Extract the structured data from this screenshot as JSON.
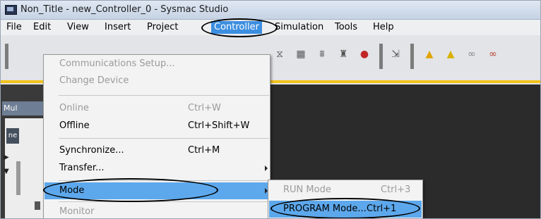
{
  "window": {
    "title": "Non_Title - new_Controller_0 - Sysmac Studio"
  },
  "menubar": {
    "items": [
      {
        "label": "File"
      },
      {
        "label": "Edit"
      },
      {
        "label": "View"
      },
      {
        "label": "Insert"
      },
      {
        "label": "Project"
      },
      {
        "label": "Controller"
      },
      {
        "label": "Simulation"
      },
      {
        "label": "Tools"
      },
      {
        "label": "Help"
      }
    ]
  },
  "left_panel": {
    "tab_label": "Mul",
    "chip_label": "ne"
  },
  "controller_menu": {
    "items": [
      {
        "label": "Communications Setup...",
        "shortcut": ""
      },
      {
        "label": "Change Device",
        "shortcut": ""
      },
      {
        "label": "Online",
        "shortcut": "Ctrl+W"
      },
      {
        "label": "Offline",
        "shortcut": "Ctrl+Shift+W"
      },
      {
        "label": "Synchronize...",
        "shortcut": "Ctrl+M"
      },
      {
        "label": "Transfer...",
        "shortcut": ""
      },
      {
        "label": "Mode",
        "shortcut": ""
      },
      {
        "label": "Monitor",
        "shortcut": ""
      }
    ]
  },
  "mode_submenu": {
    "items": [
      {
        "label": "RUN Mode",
        "shortcut": "Ctrl+3"
      },
      {
        "label": "PROGRAM Mode...",
        "shortcut": "Ctrl+1"
      }
    ]
  },
  "colors": {
    "highlight": "#5da8ec",
    "menubar_active": "#3c8ee0",
    "toolbar_accent": "#f2c21a"
  }
}
